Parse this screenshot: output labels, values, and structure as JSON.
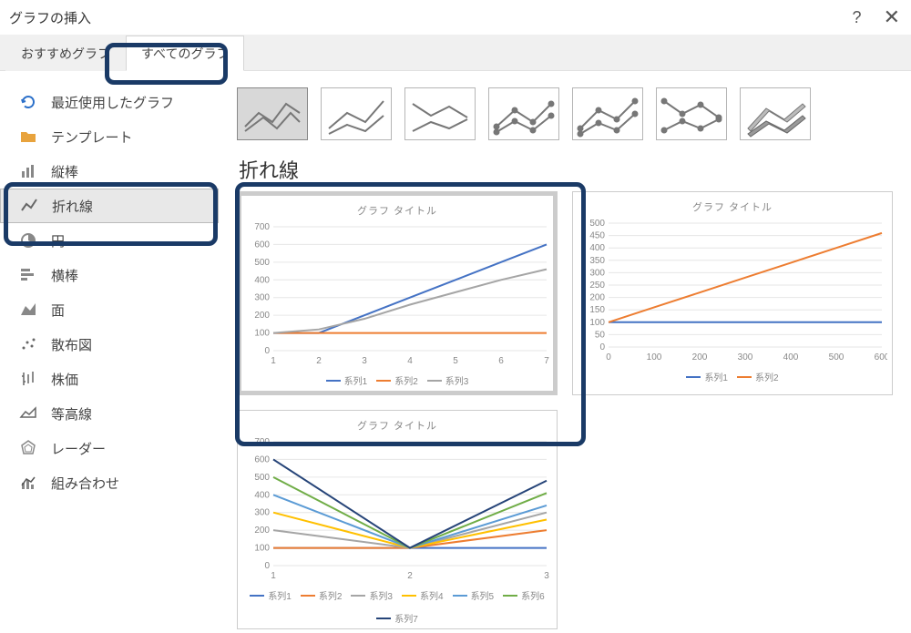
{
  "window": {
    "title": "グラフの挿入"
  },
  "tabs": [
    {
      "id": "recommended",
      "label": "おすすめグラフ",
      "active": false
    },
    {
      "id": "all",
      "label": "すべてのグラフ",
      "active": true,
      "highlighted": true
    }
  ],
  "sidebar": {
    "items": [
      {
        "id": "recent",
        "label": "最近使用したグラフ",
        "icon": "undo-icon",
        "color": "#2a6fc9"
      },
      {
        "id": "templates",
        "label": "テンプレート",
        "icon": "folder-icon",
        "color": "#d98b2b"
      },
      {
        "id": "column",
        "label": "縦棒",
        "icon": "column-chart-icon",
        "color": "#666"
      },
      {
        "id": "line",
        "label": "折れ線",
        "icon": "line-chart-icon",
        "color": "#666",
        "selected": true
      },
      {
        "id": "pie",
        "label": "円",
        "icon": "pie-chart-icon",
        "color": "#666"
      },
      {
        "id": "bar",
        "label": "横棒",
        "icon": "bar-chart-icon",
        "color": "#666"
      },
      {
        "id": "area",
        "label": "面",
        "icon": "area-chart-icon",
        "color": "#666"
      },
      {
        "id": "scatter",
        "label": "散布図",
        "icon": "scatter-chart-icon",
        "color": "#666"
      },
      {
        "id": "stock",
        "label": "株価",
        "icon": "stock-chart-icon",
        "color": "#666"
      },
      {
        "id": "surface",
        "label": "等高線",
        "icon": "surface-chart-icon",
        "color": "#666"
      },
      {
        "id": "radar",
        "label": "レーダー",
        "icon": "radar-chart-icon",
        "color": "#666"
      },
      {
        "id": "combo",
        "label": "組み合わせ",
        "icon": "combo-chart-icon",
        "color": "#666"
      }
    ]
  },
  "subtypes": [
    {
      "id": "line",
      "selected": true
    },
    {
      "id": "stacked-line"
    },
    {
      "id": "100-stacked-line"
    },
    {
      "id": "line-markers"
    },
    {
      "id": "stacked-line-markers"
    },
    {
      "id": "100-stacked-line-markers"
    },
    {
      "id": "3d-line"
    }
  ],
  "section_title": "折れ線",
  "chart_data": [
    {
      "id": "preview1",
      "type": "line",
      "title": "グラフ タイトル",
      "categories": [
        1,
        2,
        3,
        4,
        5,
        6,
        7
      ],
      "yticks": [
        0,
        100,
        200,
        300,
        400,
        500,
        600,
        700
      ],
      "ylim": [
        0,
        700
      ],
      "series": [
        {
          "name": "系列1",
          "color": "#4472c4",
          "values": [
            100,
            100,
            200,
            300,
            400,
            500,
            600
          ]
        },
        {
          "name": "系列2",
          "color": "#ed7d31",
          "values": [
            100,
            100,
            100,
            100,
            100,
            100,
            100
          ]
        },
        {
          "name": "系列3",
          "color": "#a5a5a5",
          "values": [
            100,
            120,
            180,
            260,
            330,
            400,
            460
          ]
        }
      ]
    },
    {
      "id": "preview2",
      "type": "line",
      "title": "グラフ タイトル",
      "categories": [
        0,
        100,
        200,
        300,
        400,
        500,
        600
      ],
      "yticks": [
        0,
        50,
        100,
        150,
        200,
        250,
        300,
        350,
        400,
        450,
        500
      ],
      "ylim": [
        0,
        500
      ],
      "series": [
        {
          "name": "系列1",
          "color": "#4472c4",
          "values": [
            100,
            100,
            100,
            100,
            100,
            100,
            100
          ]
        },
        {
          "name": "系列2",
          "color": "#ed7d31",
          "values": [
            100,
            160,
            220,
            280,
            340,
            400,
            460
          ]
        }
      ]
    },
    {
      "id": "preview3",
      "type": "line",
      "title": "グラフ タイトル",
      "categories": [
        1,
        2,
        3
      ],
      "yticks": [
        0,
        100,
        200,
        300,
        400,
        500,
        600,
        700
      ],
      "ylim": [
        0,
        700
      ],
      "series": [
        {
          "name": "系列1",
          "color": "#4472c4",
          "values": [
            100,
            100,
            100
          ]
        },
        {
          "name": "系列2",
          "color": "#ed7d31",
          "values": [
            100,
            100,
            200
          ]
        },
        {
          "name": "系列3",
          "color": "#a5a5a5",
          "values": [
            200,
            100,
            300
          ]
        },
        {
          "name": "系列4",
          "color": "#ffc000",
          "values": [
            300,
            100,
            260
          ]
        },
        {
          "name": "系列5",
          "color": "#5b9bd5",
          "values": [
            400,
            100,
            340
          ]
        },
        {
          "name": "系列6",
          "color": "#70ad47",
          "values": [
            500,
            100,
            410
          ]
        },
        {
          "name": "系列7",
          "color": "#264478",
          "values": [
            600,
            100,
            480
          ]
        }
      ]
    }
  ]
}
